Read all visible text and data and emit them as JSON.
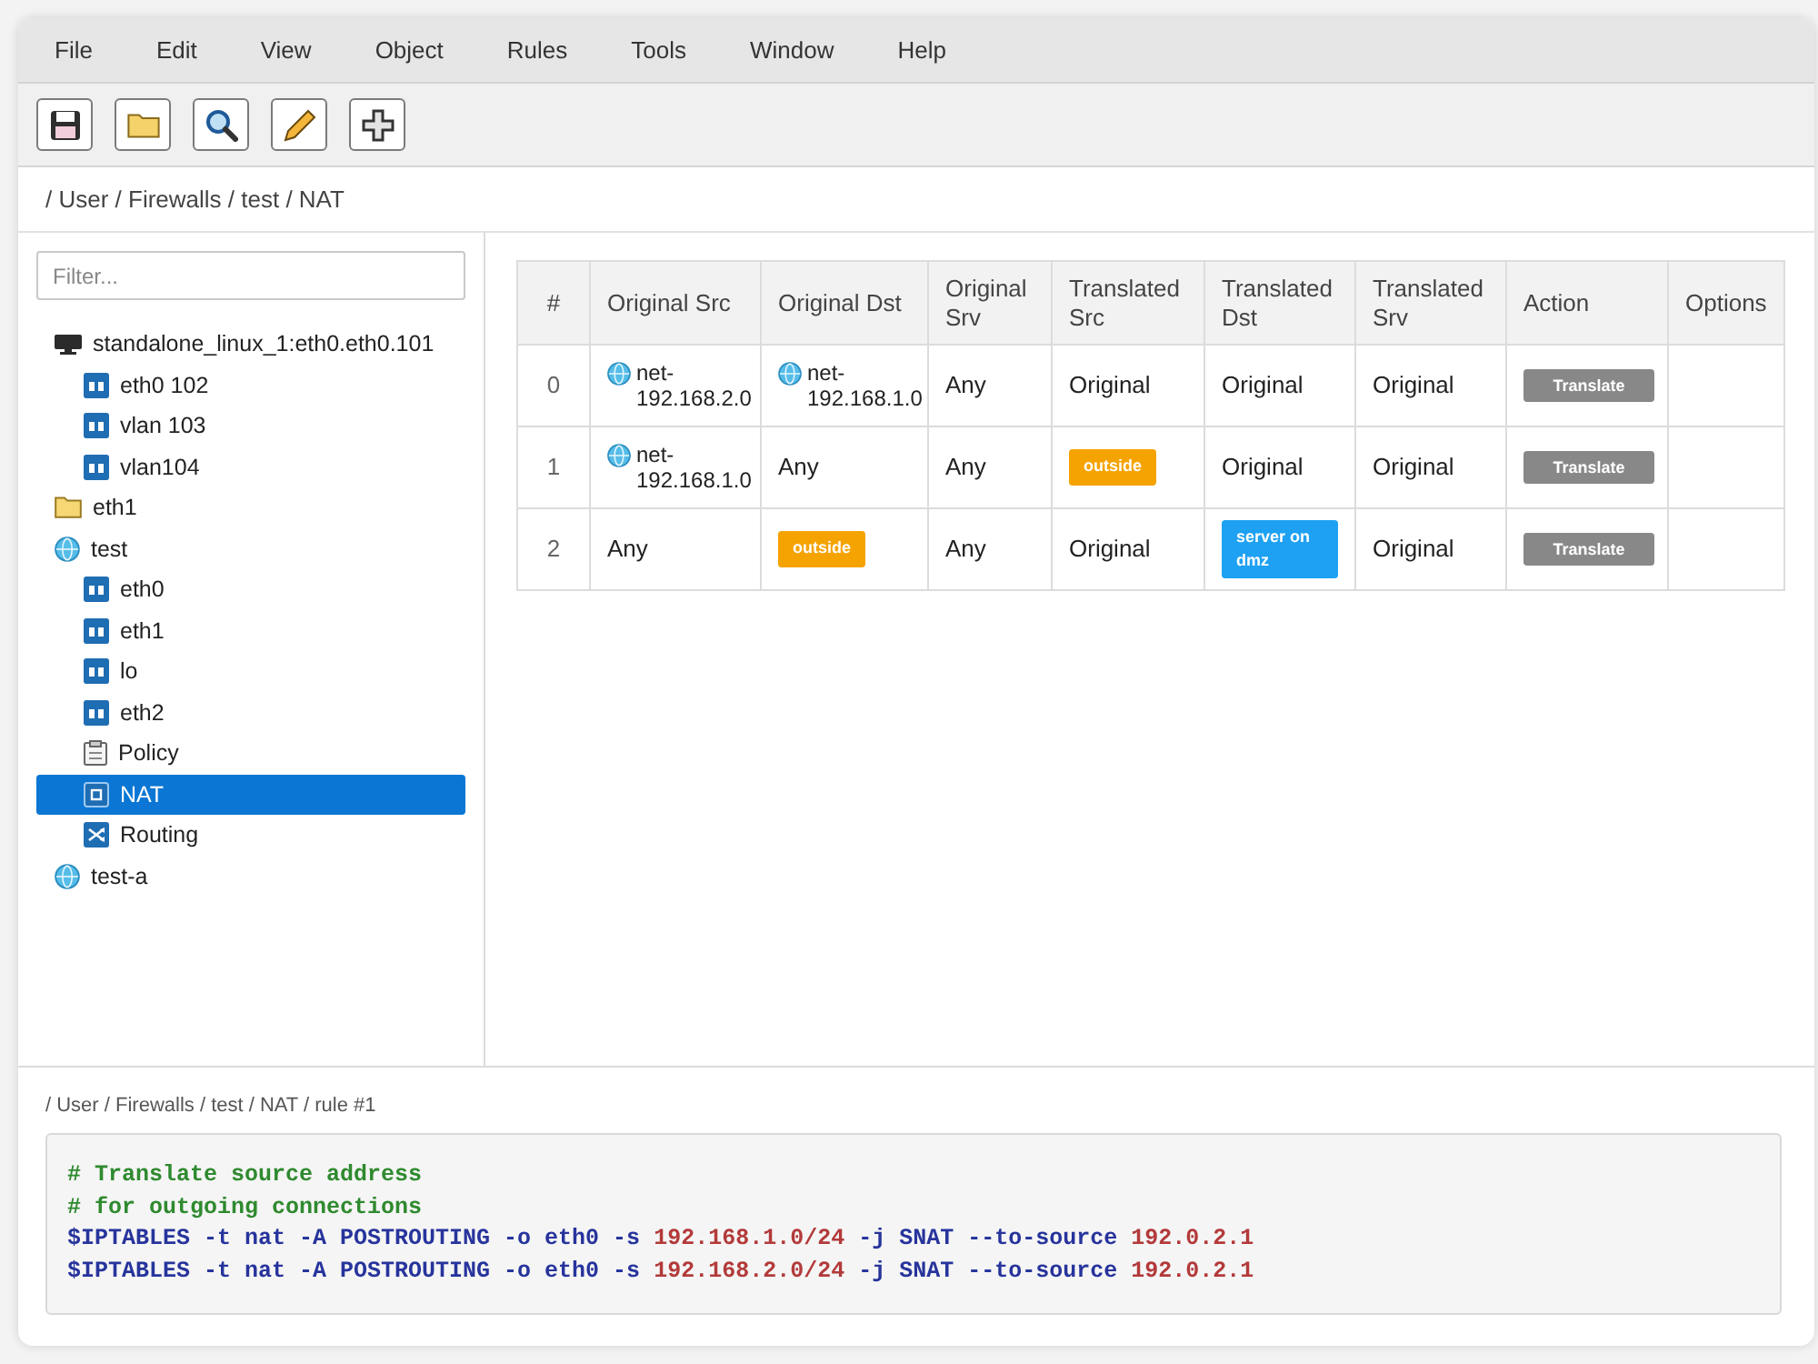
{
  "menu_bar": [
    "File",
    "Edit",
    "View",
    "Object",
    "Rules",
    "Tools",
    "Window",
    "Help"
  ],
  "toolbar": [
    {
      "kind": "save"
    },
    {
      "kind": "open"
    },
    {
      "kind": "search"
    },
    {
      "kind": "edit"
    },
    {
      "kind": "add"
    }
  ],
  "breadcrumb": "/ User / Firewalls / test / NAT",
  "sidebar": {
    "filter": {
      "placeholder": "Filter..."
    },
    "tree": [
      {
        "label": "standalone_linux_1:eth0.eth0.101",
        "kind": "host",
        "selected": false,
        "children": [
          {
            "label": "eth0 102",
            "kind": "interface",
            "selected": false
          },
          {
            "label": "vlan 103",
            "kind": "interface",
            "selected": false
          },
          {
            "label": "vlan104",
            "kind": "interface",
            "selected": false
          }
        ]
      },
      {
        "label": "eth1",
        "kind": "folder",
        "selected": false
      },
      {
        "label": "test",
        "kind": "firewall",
        "selected": false,
        "children": [
          {
            "label": "eth0",
            "kind": "interface",
            "selected": false
          },
          {
            "label": "eth1",
            "kind": "interface",
            "selected": false
          },
          {
            "label": "lo",
            "kind": "interface",
            "selected": false
          },
          {
            "label": "eth2",
            "kind": "interface",
            "selected": false
          },
          {
            "label": "Policy",
            "kind": "policy",
            "selected": false
          },
          {
            "label": "NAT",
            "kind": "nat",
            "selected": true
          },
          {
            "label": "Routing",
            "kind": "routing",
            "selected": false
          }
        ]
      },
      {
        "label": "test-a",
        "kind": "firewall",
        "selected": false
      }
    ]
  },
  "table": {
    "columns": [
      "#",
      "Original Src",
      "Original Dst",
      "Original Srv",
      "Translated Src",
      "Translated Dst",
      "Translated Srv",
      "Action",
      "Options"
    ],
    "rows": [
      {
        "cells": [
          {
            "kind": "index",
            "text": "0"
          },
          {
            "kind": "object",
            "text": "net-192.168.2.0"
          },
          {
            "kind": "object",
            "text": "net-192.168.1.0"
          },
          {
            "kind": "text",
            "text": "Any"
          },
          {
            "kind": "text",
            "text": "Original"
          },
          {
            "kind": "text",
            "text": "Original"
          },
          {
            "kind": "text",
            "text": "Original"
          },
          {
            "kind": "button",
            "text": "Translate"
          }
        ]
      },
      {
        "cells": [
          {
            "kind": "index",
            "text": "1"
          },
          {
            "kind": "object",
            "text": "net-192.168.1.0"
          },
          {
            "kind": "text",
            "text": "Any"
          },
          {
            "kind": "text",
            "text": "Any"
          },
          {
            "kind": "tag",
            "text": "outside",
            "color": "#f5a300"
          },
          {
            "kind": "text",
            "text": "Original"
          },
          {
            "kind": "text",
            "text": "Original"
          },
          {
            "kind": "button",
            "text": "Translate"
          }
        ]
      },
      {
        "cells": [
          {
            "kind": "index",
            "text": "2"
          },
          {
            "kind": "text",
            "text": "Any"
          },
          {
            "kind": "tag",
            "text": "outside",
            "color": "#f5a300"
          },
          {
            "kind": "text",
            "text": "Any"
          },
          {
            "kind": "text",
            "text": "Original"
          },
          {
            "kind": "tag",
            "text": "server on dmz",
            "color": "#1ea1f2"
          },
          {
            "kind": "text",
            "text": "Original"
          },
          {
            "kind": "button",
            "text": "Translate"
          }
        ]
      }
    ]
  },
  "detail_panel": {
    "breadcrumb": "/ User / Firewalls / test / NAT / rule #1",
    "code_lines": [
      {
        "segments": [
          {
            "kind": "comment",
            "text": "# Translate source address"
          }
        ]
      },
      {
        "segments": [
          {
            "kind": "comment",
            "text": "# for outgoing connections"
          }
        ]
      },
      {
        "segments": [
          {
            "kind": "command",
            "text": "$IPTABLES -t nat -A POSTROUTING -o eth0 -s "
          },
          {
            "kind": "address",
            "text": "192.168.1.0/24"
          },
          {
            "kind": "command",
            "text": " -j SNAT --to-source "
          },
          {
            "kind": "address",
            "text": "192.0.2.1"
          }
        ]
      },
      {
        "segments": [
          {
            "kind": "command",
            "text": "$IPTABLES -t nat -A POSTROUTING -o eth0 -s "
          },
          {
            "kind": "address",
            "text": "192.168.2.0/24"
          },
          {
            "kind": "command",
            "text": " -j SNAT --to-source "
          },
          {
            "kind": "address",
            "text": "192.0.2.1"
          }
        ]
      }
    ]
  }
}
